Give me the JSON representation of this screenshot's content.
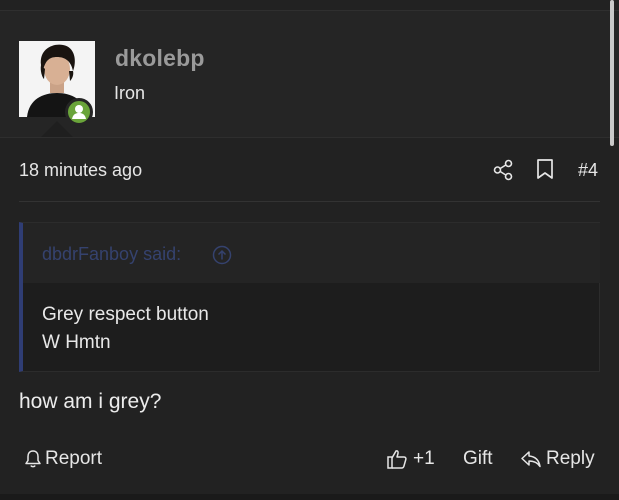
{
  "post": {
    "author": {
      "username": "dkolebp",
      "title": "Iron",
      "avatar_icon": "profile-photo",
      "status_icon": "user-online-icon",
      "status_color": "#6aa43a"
    },
    "timestamp": "18 minutes ago",
    "post_number": "#4",
    "quote": {
      "author_label": "dbdrFanboy said:",
      "lines": [
        "Grey respect button",
        "W Hmtn"
      ],
      "accent_color": "#2f3d74"
    },
    "message": "how am i grey?",
    "actions": {
      "report": "Report",
      "like": "+1",
      "gift": "Gift",
      "reply": "Reply"
    }
  }
}
